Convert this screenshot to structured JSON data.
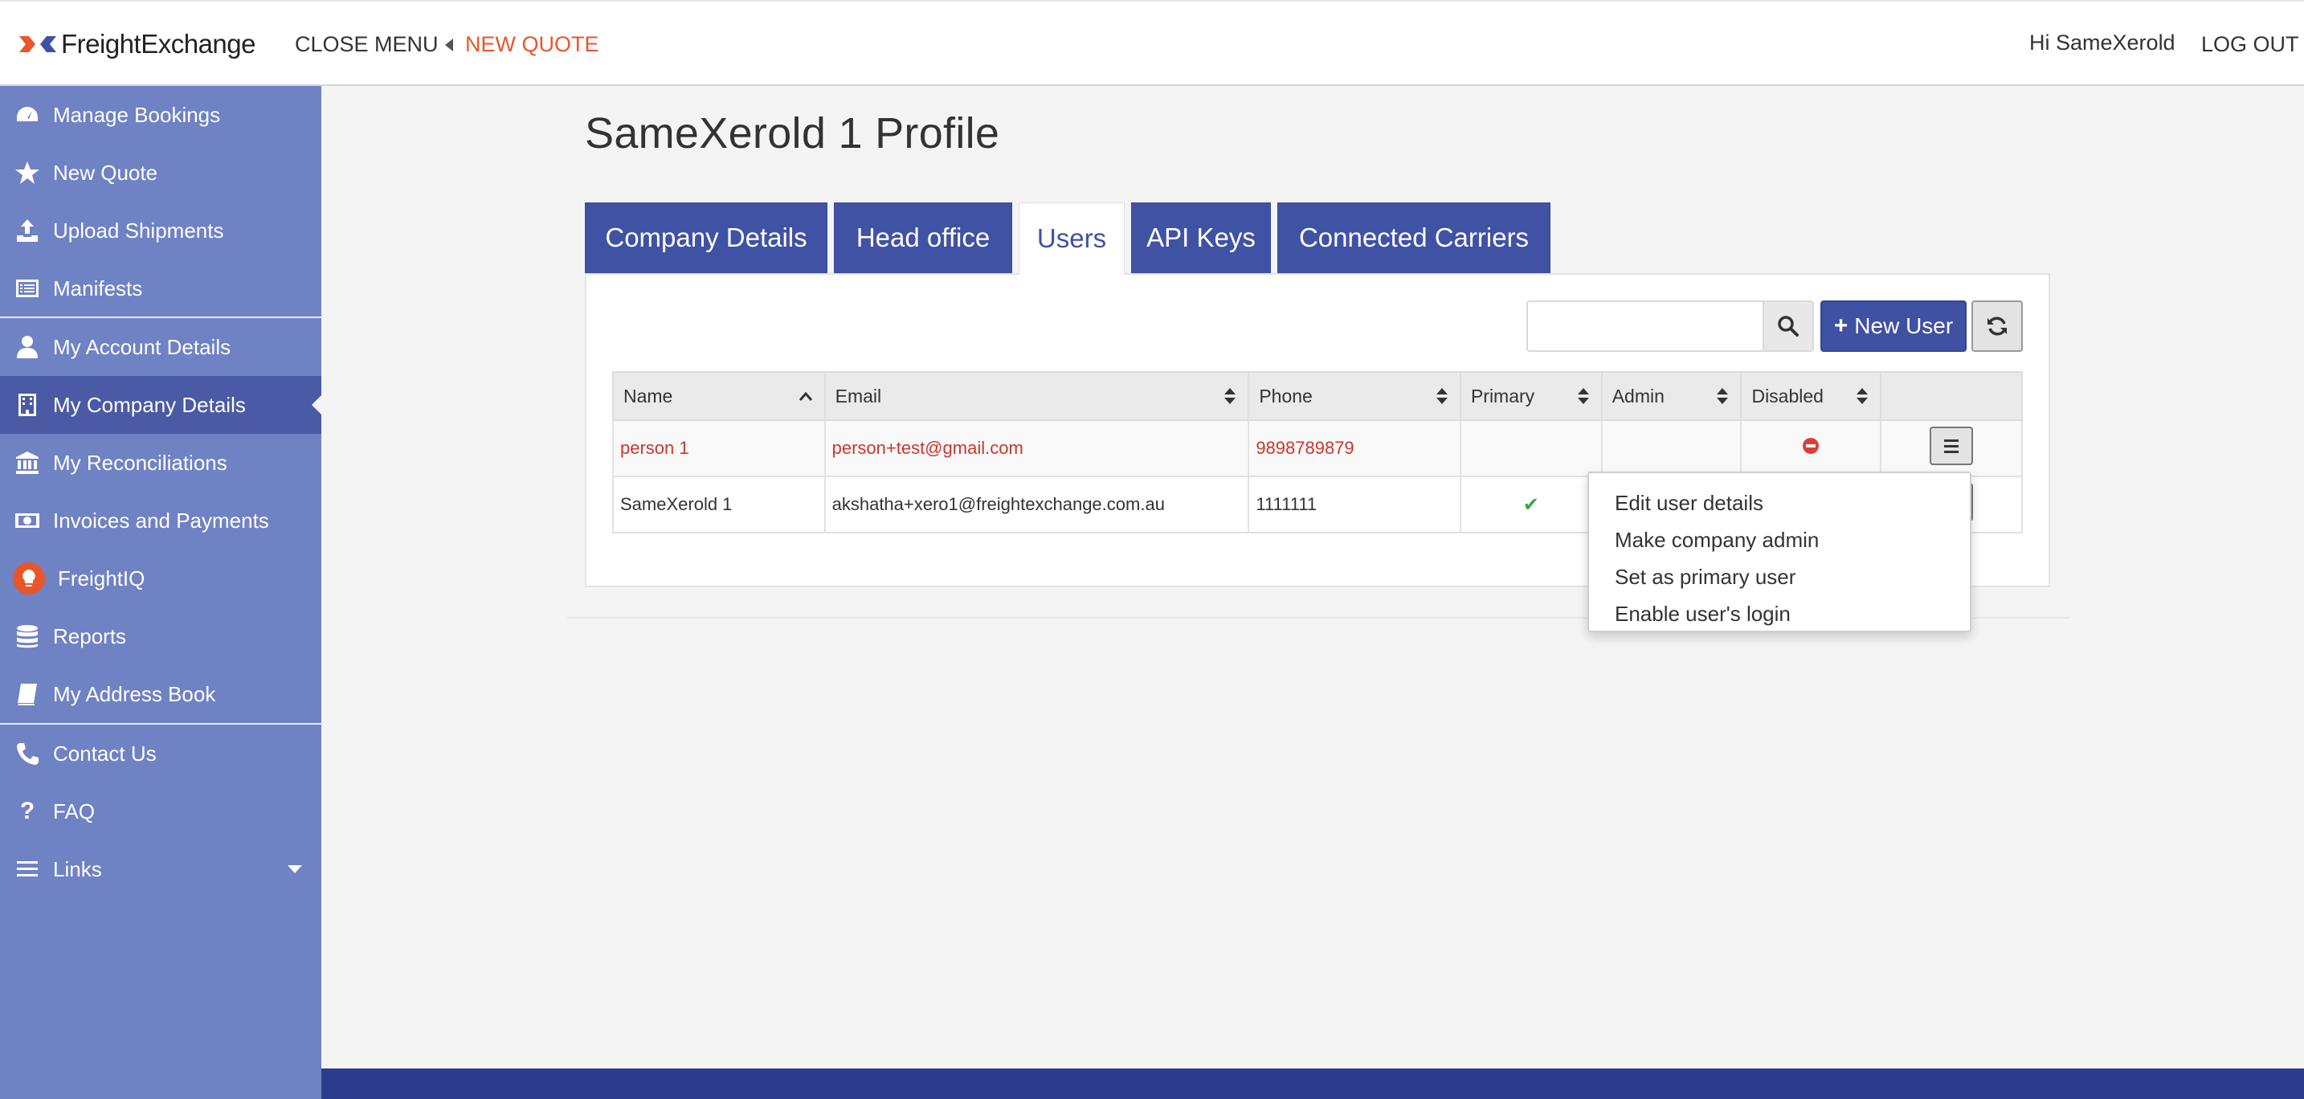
{
  "header": {
    "logo_text": "FreightExchange",
    "close_menu": "CLOSE MENU",
    "new_quote": "NEW QUOTE",
    "greeting": "Hi SameXerold",
    "logout": "LOG OUT"
  },
  "sidebar": {
    "items": [
      {
        "label": "Manage Bookings",
        "icon": "dashboard-icon"
      },
      {
        "label": "New Quote",
        "icon": "star-icon"
      },
      {
        "label": "Upload Shipments",
        "icon": "upload-icon"
      },
      {
        "label": "Manifests",
        "icon": "list-icon"
      },
      {
        "label": "My Account Details",
        "icon": "user-icon"
      },
      {
        "label": "My Company Details",
        "icon": "building-icon"
      },
      {
        "label": "My Reconciliations",
        "icon": "bank-icon"
      },
      {
        "label": "Invoices and Payments",
        "icon": "money-icon"
      },
      {
        "label": "FreightIQ",
        "icon": "lightbulb-icon"
      },
      {
        "label": "Reports",
        "icon": "database-icon"
      },
      {
        "label": "My Address Book",
        "icon": "book-icon"
      },
      {
        "label": "Contact Us",
        "icon": "phone-icon"
      },
      {
        "label": "FAQ",
        "icon": "question-icon"
      },
      {
        "label": "Links",
        "icon": "bars-icon"
      }
    ]
  },
  "page": {
    "title": "SameXerold 1 Profile"
  },
  "tabs": [
    "Company Details",
    "Head office",
    "Users",
    "API Keys",
    "Connected Carriers"
  ],
  "toolbar": {
    "search_placeholder": "",
    "new_user": "New User"
  },
  "table": {
    "columns": [
      "Name",
      "Email",
      "Phone",
      "Primary",
      "Admin",
      "Disabled"
    ],
    "rows": [
      {
        "name": "person 1",
        "email": "person+test@gmail.com",
        "phone": "9898789879",
        "primary": false,
        "admin": false,
        "disabled": true
      },
      {
        "name": "SameXerold 1",
        "email": "akshatha+xero1@freightexchange.com.au",
        "phone": "1111111",
        "primary": true,
        "admin": false,
        "disabled": false
      }
    ]
  },
  "dropdown": {
    "items": [
      "Edit user details",
      "Make company admin",
      "Set as primary user",
      "Enable user's login"
    ]
  },
  "colors": {
    "sidebar": "#6f82c4",
    "sidebar_active": "#4a5aa5",
    "brand_blue": "#3f51a3",
    "accent_orange": "#e8562a",
    "error_red": "#c8372e",
    "footer": "#2d3b8c"
  }
}
